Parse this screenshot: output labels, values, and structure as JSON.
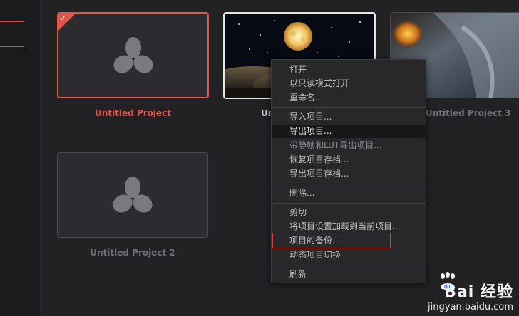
{
  "projects": [
    {
      "name": "Untitled Project",
      "state": "selected"
    },
    {
      "name": "Un",
      "state": "thumbnail-moon"
    },
    {
      "name": "Untitled Project 3",
      "state": "thumbnail-storm"
    },
    {
      "name": "Untitled Project 2",
      "state": "default"
    }
  ],
  "context_menu": {
    "items": [
      {
        "label": "打开"
      },
      {
        "label": "以只读模式打开"
      },
      {
        "label": "重命名..."
      },
      {
        "label": "导入项目..."
      },
      {
        "label": "导出项目..."
      },
      {
        "label": "带静帧和LUT导出项目..."
      },
      {
        "label": "恢复项目存档..."
      },
      {
        "label": "导出项目存档..."
      },
      {
        "label": "删除..."
      },
      {
        "label": "剪切"
      },
      {
        "label": "将项目设置加载到当前项目..."
      },
      {
        "label": "项目的备份..."
      },
      {
        "label": "动态项目切换"
      },
      {
        "label": "刷新"
      }
    ],
    "highlighted": "导出项目...",
    "annotated": "项目的备份..."
  },
  "watermark": {
    "brand": "Bai 经验",
    "paw": "du",
    "url": "jingyan.baidu.com"
  },
  "colors": {
    "accent": "#e0564a",
    "annotation": "#e33b2e"
  },
  "icons": [
    "davinci-logo-icon",
    "check-corner-icon",
    "baidu-paw-icon"
  ]
}
